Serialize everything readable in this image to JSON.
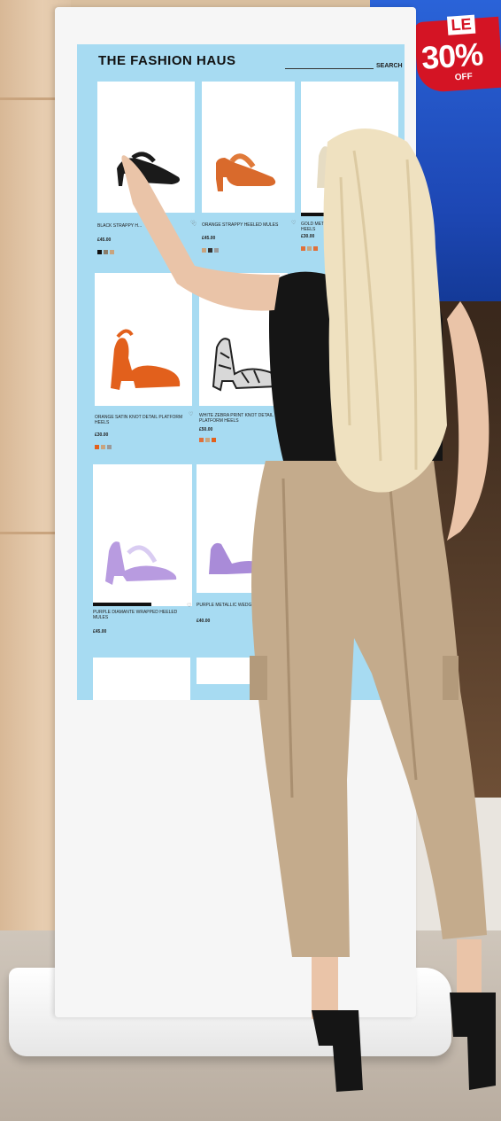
{
  "store": {
    "brand": "THE FASHION HAUS",
    "search_label": "SEARCH"
  },
  "promo": {
    "sale_text": "LE",
    "percent": "30%",
    "off": "OFF",
    "badge_color": "#d41424",
    "screen_color": "#1d47b4"
  },
  "display": {
    "background": "#a7dbf2",
    "products": [
      {
        "name": "BLACK STRAPPY H...",
        "price": "£45.00",
        "swatches": [
          "#111111",
          "#8a7d6b",
          "#c9a47e"
        ]
      },
      {
        "name": "ORANGE STRAPPY HEELED MULES",
        "price": "£45.00",
        "swatches": [
          "#c9a47e",
          "#333333",
          "#9a9a9a"
        ]
      },
      {
        "name": "GOLD METAL... HEELS",
        "price": "£30.00",
        "swatches": [
          "#e0703a",
          "#c9a47e",
          "#e0703a"
        ]
      },
      {
        "name": "ORANGE SATIN KNOT DETAIL PLATFORM HEELS",
        "price": "£30.00",
        "swatches": [
          "#e2601c",
          "#c9a47e",
          "#9a9a9a"
        ]
      },
      {
        "name": "WHITE ZEBRA PRINT KNOT DETAIL PLATFORM HEELS",
        "price": "£50.00",
        "swatches": [
          "#e0703a",
          "#c9a47e",
          "#e2601c"
        ]
      },
      {
        "name": "PURPLE DIAMANTE WRAPPED HEELED MULES",
        "price": "£45.00",
        "swatches": []
      },
      {
        "name": "PURPLE METALLIC WEDG...",
        "price": "£40.00",
        "swatches": []
      }
    ]
  },
  "colors": {
    "kiosk": "#f6f6f6",
    "shoe_black": "#1a1a1a",
    "shoe_orange": "#e2601c",
    "shoe_purple": "#b89be0",
    "shoe_gold": "#e6dcc3"
  }
}
